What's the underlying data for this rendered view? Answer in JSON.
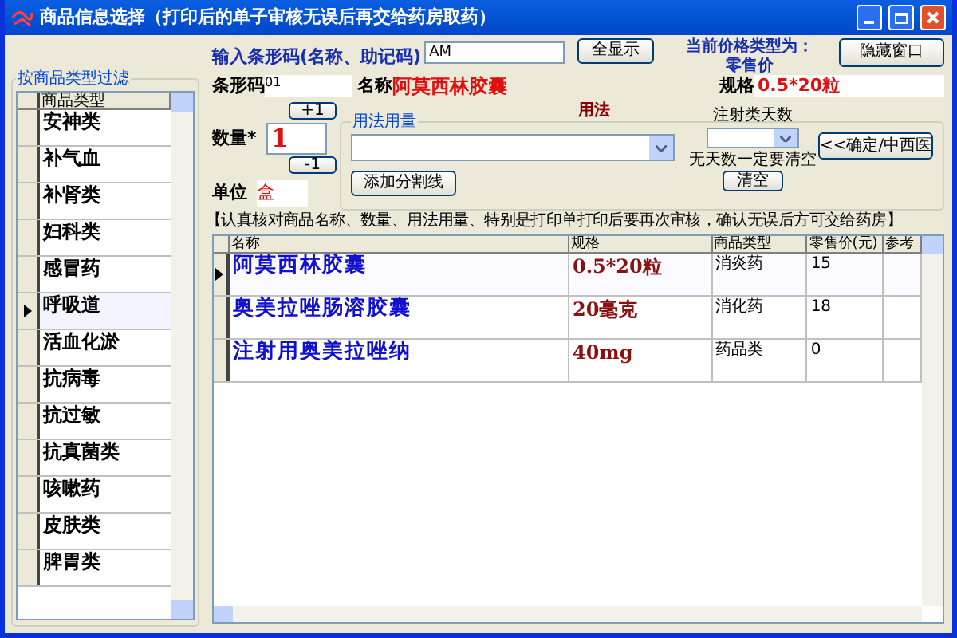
{
  "window": {
    "title": "商品信息选择（打印后的单子审核无误后再交给药房取药）"
  },
  "filter": {
    "title": "按商品类型过滤",
    "column": "商品类型",
    "items": [
      {
        "label": "安神类",
        "selected": false
      },
      {
        "label": "补气血",
        "selected": false
      },
      {
        "label": "补肾类",
        "selected": false
      },
      {
        "label": "妇科类",
        "selected": false
      },
      {
        "label": "感冒药",
        "selected": false
      },
      {
        "label": "呼吸道",
        "selected": true
      },
      {
        "label": "活血化淤",
        "selected": false
      },
      {
        "label": "抗病毒",
        "selected": false
      },
      {
        "label": "抗过敏",
        "selected": false
      },
      {
        "label": "抗真菌类",
        "selected": false
      },
      {
        "label": "咳嗽药",
        "selected": false
      },
      {
        "label": "皮肤类",
        "selected": false
      },
      {
        "label": "脾胃类",
        "selected": false
      }
    ]
  },
  "search": {
    "label": "输入条形码(名称、助记码)",
    "value": "AM",
    "show_all_button": "全显示"
  },
  "price_type": {
    "label": "当前价格类型为：",
    "value": "零售价"
  },
  "hide_button": "隐藏窗口",
  "barcode": {
    "label": "条形码",
    "value": "01"
  },
  "name": {
    "label": "名称",
    "value": "阿莫西林胶囊"
  },
  "spec": {
    "label": "规格",
    "value": "0.5*20粒"
  },
  "quantity": {
    "label": "数量*",
    "value": "1",
    "plus": "+1",
    "minus": "-1"
  },
  "unit": {
    "label": "单位",
    "value": "盒"
  },
  "usage_title": "用法",
  "usage": {
    "title": "用法用量",
    "injection_days_label": "注射类天数",
    "confirm_button": "<<确定/中西医",
    "hint": "无天数一定要清空",
    "clear_button": "清空"
  },
  "separator_button": "添加分割线",
  "notice": "【认真核对商品名称、数量、用法用量、特别是打印单打印后要再次审核，确认无误后方可交给药房】",
  "table": {
    "columns": [
      "名称",
      "规格",
      "商品类型",
      "零售价(元)",
      "参考"
    ],
    "rows": [
      {
        "name": "阿莫西林胶囊",
        "spec": "0.5*20粒",
        "type": "消炎药",
        "price": "15",
        "selected": true
      },
      {
        "name": "奥美拉唑肠溶胶囊",
        "spec": "20毫克",
        "type": "消化药",
        "price": "18",
        "selected": false
      },
      {
        "name": "注射用奥美拉唑纳",
        "spec": "40mg",
        "type": "药品类",
        "price": "0",
        "selected": false
      }
    ]
  }
}
